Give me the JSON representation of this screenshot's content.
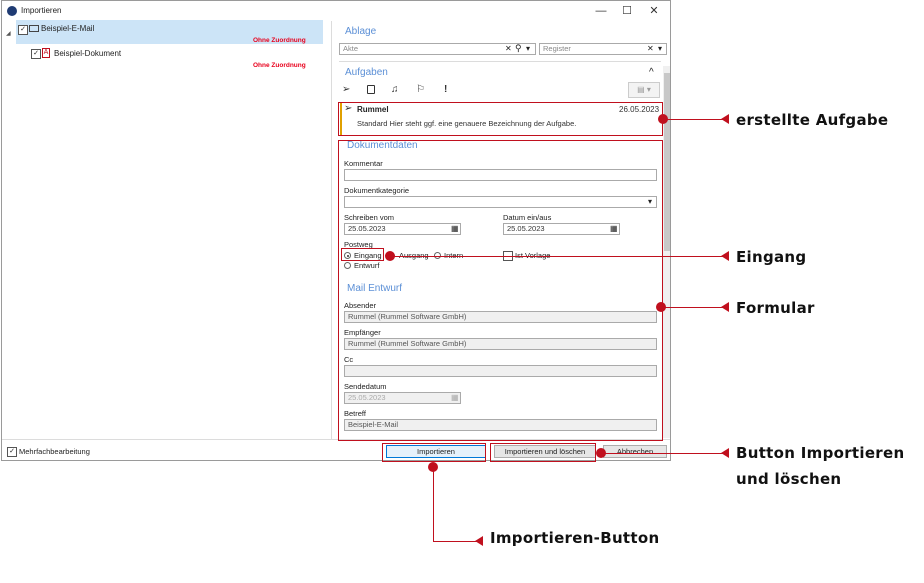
{
  "window": {
    "title": "Importieren",
    "minimize": "—",
    "maximize": "☐",
    "close": "✕"
  },
  "tree": {
    "expander": "◢",
    "items": [
      {
        "label": "Beispiel-E-Mail",
        "status": "Ohne Zuordnung"
      },
      {
        "label": "Beispiel-Dokument",
        "status": "Ohne Zuordnung"
      }
    ]
  },
  "ablage": {
    "title": "Ablage",
    "akte_placeholder": "Akte",
    "register_placeholder": "Register",
    "clear": "✕",
    "search": "⚲",
    "dropdown": "▾"
  },
  "aufgaben": {
    "title": "Aufgaben",
    "collapse": "^",
    "task": {
      "author": "Rummel",
      "date": "26.05.2023",
      "text": "Standard Hier steht ggf. eine genauere Bezeichnung der Aufgabe."
    }
  },
  "dokumentdaten": {
    "title": "Dokumentdaten",
    "kommentar_label": "Kommentar",
    "kommentar_value": "",
    "kategorie_label": "Dokumentkategorie",
    "kategorie_value": "",
    "schreiben_label": "Schreiben vom",
    "schreiben_value": "25.05.2023",
    "datum_label": "Datum ein/aus",
    "datum_value": "25.05.2023",
    "postweg_label": "Postweg",
    "postweg_options": [
      "Eingang",
      "Ausgang",
      "Intern",
      "Entwurf"
    ],
    "vorlage_label": "Ist Vorlage"
  },
  "mail": {
    "title": "Mail Entwurf",
    "absender_label": "Absender",
    "absender_value": "Rummel (Rummel Software GmbH)",
    "empfaenger_label": "Empfänger",
    "empfaenger_value": "Rummel (Rummel Software GmbH)",
    "cc_label": "Cc",
    "cc_value": "",
    "sendedatum_label": "Sendedatum",
    "sendedatum_value": "25.05.2023",
    "betreff_label": "Betreff",
    "betreff_value": "Beispiel-E-Mail"
  },
  "footer": {
    "mehrfach_label": "Mehrfachbearbeitung",
    "importieren": "Importieren",
    "importieren_loeschen": "Importieren und löschen",
    "abbrechen": "Abbrechen"
  },
  "callouts": {
    "aufgabe": "erstellte Aufgabe",
    "eingang": "Eingang",
    "formular": "Formular",
    "btn_loeschen_1": "Button Importieren",
    "btn_loeschen_2": "und löschen",
    "importieren_button": "Importieren-Button"
  },
  "colors": {
    "accent": "#5b8fd6",
    "callout": "#c0101e",
    "status": "#e8001c"
  }
}
